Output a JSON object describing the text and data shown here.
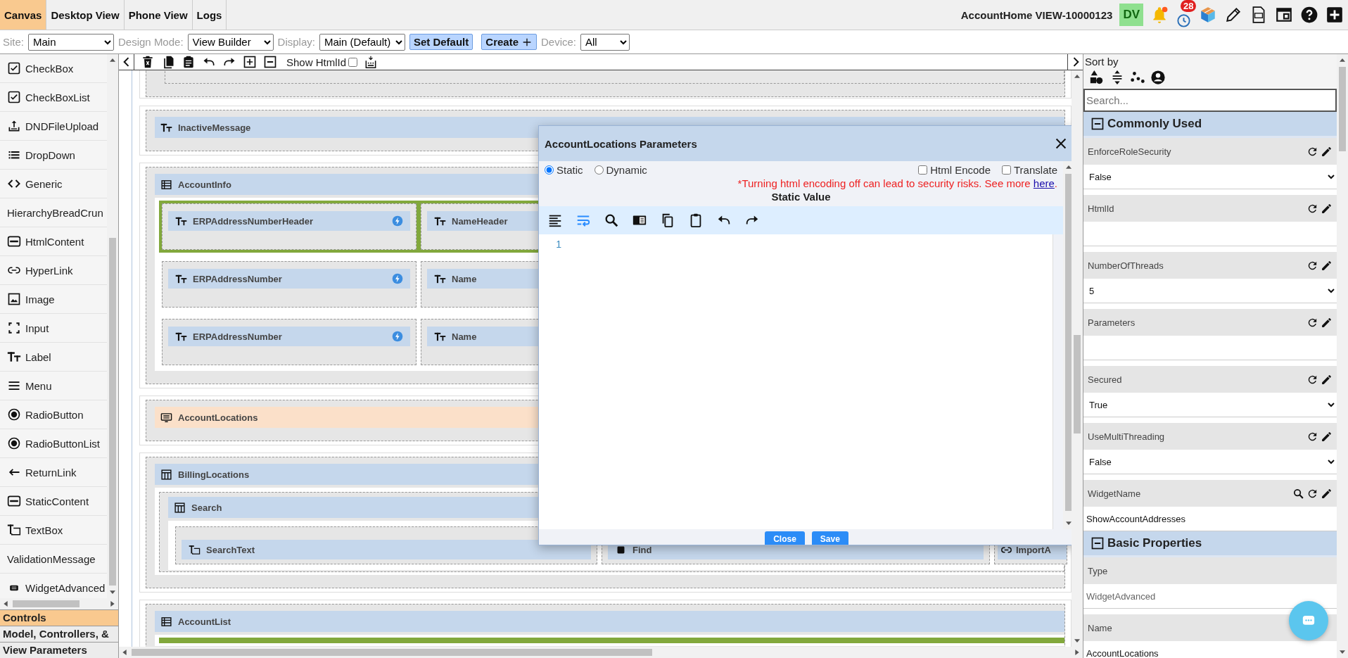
{
  "top_tabs": [
    {
      "label": "Canvas",
      "selected": true
    },
    {
      "label": "Desktop View",
      "selected": false
    },
    {
      "label": "Phone View",
      "selected": false
    },
    {
      "label": "Logs",
      "selected": false
    }
  ],
  "view_title": "AccountHome VIEW-10000123",
  "user_badge": "DV",
  "notification_count": "28",
  "filters": [
    {
      "label": "Site:",
      "value": "Main"
    },
    {
      "label": "Design Mode:",
      "value": "View Builder"
    },
    {
      "label": "Display:",
      "value": "Main (Default)"
    }
  ],
  "set_default_button": "Set Default",
  "create_button": "Create",
  "device": {
    "label": "Device:",
    "value": "All"
  },
  "canvas_toolbar": {
    "show_htmlid": {
      "label": "Show HtmlId",
      "checked": false
    }
  },
  "controls": [
    {
      "label": "CheckBox",
      "kind": "checkbox"
    },
    {
      "label": "CheckBoxList",
      "kind": "checkbox"
    },
    {
      "label": "DNDFileUpload",
      "kind": "upload"
    },
    {
      "label": "DropDown",
      "kind": "list"
    },
    {
      "label": "Generic",
      "kind": "code"
    },
    {
      "label": "HierarchyBreadCrun",
      "kind": "none"
    },
    {
      "label": "HtmlContent",
      "kind": "html"
    },
    {
      "label": "HyperLink",
      "kind": "link"
    },
    {
      "label": "Image",
      "kind": "image"
    },
    {
      "label": "Input",
      "kind": "input"
    },
    {
      "label": "Label",
      "kind": "label"
    },
    {
      "label": "Menu",
      "kind": "menu"
    },
    {
      "label": "RadioButton",
      "kind": "radio"
    },
    {
      "label": "RadioButtonList",
      "kind": "radio"
    },
    {
      "label": "ReturnLink",
      "kind": "return"
    },
    {
      "label": "StaticContent",
      "kind": "html"
    },
    {
      "label": "TextBox",
      "kind": "textbox"
    },
    {
      "label": "ValidationMessage",
      "kind": "none"
    },
    {
      "label": "WidgetAdvanced",
      "kind": "widget"
    }
  ],
  "sidebar_sections": [
    {
      "label": "Controls",
      "selected": true
    },
    {
      "label": "Model, Controllers, &",
      "selected": false
    },
    {
      "label": "View Parameters",
      "selected": false
    }
  ],
  "canvas": {
    "sections": [
      {
        "kind": "label",
        "title": "InactiveMessage",
        "selected": false
      },
      {
        "kind": "table",
        "title": "AccountInfo",
        "selected": false,
        "rows": [
          {
            "highlighted": true,
            "cells": [
              {
                "kind": "label",
                "title": "ERPAddressNumberHeader",
                "event": true
              },
              {
                "kind": "label",
                "title": "NameHeader"
              }
            ]
          },
          {
            "highlighted": false,
            "cells": [
              {
                "kind": "label",
                "title": "ERPAddressNumber",
                "event": true
              },
              {
                "kind": "label",
                "title": "Name"
              }
            ]
          },
          {
            "highlighted": false,
            "cells": [
              {
                "kind": "label",
                "title": "ERPAddressNumber",
                "event": true
              },
              {
                "kind": "label",
                "title": "Name"
              }
            ]
          }
        ]
      },
      {
        "kind": "widget",
        "title": "AccountLocations",
        "selected": true
      },
      {
        "kind": "grid",
        "title": "BillingLocations",
        "selected": false,
        "children": [
          {
            "kind": "grid",
            "title": "Search",
            "rows": [
              {
                "highlighted": false,
                "cells": [
                  {
                    "kind": "textbox",
                    "title": "SearchText",
                    "event": false
                  },
                  {
                    "kind": "button",
                    "title": "Find",
                    "event": false
                  },
                  {
                    "kind": "link",
                    "title": "ImportA",
                    "event": false
                  }
                ]
              }
            ]
          }
        ]
      },
      {
        "kind": "table",
        "title": "AccountList",
        "selected": false,
        "rows": [
          {
            "highlighted": true
          }
        ]
      }
    ]
  },
  "dialog": {
    "title": "AccountLocations Parameters",
    "modes": [
      {
        "label": "Static",
        "selected": true
      },
      {
        "label": "Dynamic",
        "selected": false
      }
    ],
    "options": [
      {
        "label": "Html Encode",
        "checked": false
      },
      {
        "label": "Translate",
        "checked": false
      }
    ],
    "warning": "*Turning html encoding off can lead to security risks. See more",
    "warning_link": "here",
    "warning_end": ".",
    "value_label": "Static Value",
    "line_numbers": [
      "1"
    ],
    "buttons": [
      "Close",
      "Save"
    ]
  },
  "properties": {
    "sort_label": "Sort by",
    "search": {
      "placeholder": "Search..."
    },
    "groups": [
      {
        "title": "Commonly Used",
        "expanded": true,
        "items": [
          {
            "name": "EnforceRoleSecurity",
            "kind": "select",
            "value": "False",
            "editable": true,
            "searchable": false
          },
          {
            "name": "HtmlId",
            "kind": "text",
            "editable": true,
            "searchable": false
          },
          {
            "name": "NumberOfThreads",
            "kind": "select",
            "value": "5",
            "editable": true,
            "searchable": false
          },
          {
            "name": "Parameters",
            "kind": "text",
            "editable": true,
            "searchable": false
          },
          {
            "name": "Secured",
            "kind": "select",
            "value": "True",
            "editable": true,
            "searchable": false
          },
          {
            "name": "UseMultiThreading",
            "kind": "select",
            "value": "False",
            "editable": true,
            "searchable": false
          },
          {
            "name": "WidgetName",
            "kind": "text",
            "value": "ShowAccountAddresses",
            "editable": true,
            "searchable": true
          }
        ]
      },
      {
        "title": "Basic Properties",
        "expanded": true,
        "items": [
          {
            "name": "Type",
            "kind": "static",
            "value": "WidgetAdvanced",
            "editable": false,
            "searchable": false
          },
          {
            "name": "Name",
            "kind": "text",
            "value": "AccountLocations",
            "editable": false,
            "searchable": false
          }
        ]
      }
    ]
  }
}
